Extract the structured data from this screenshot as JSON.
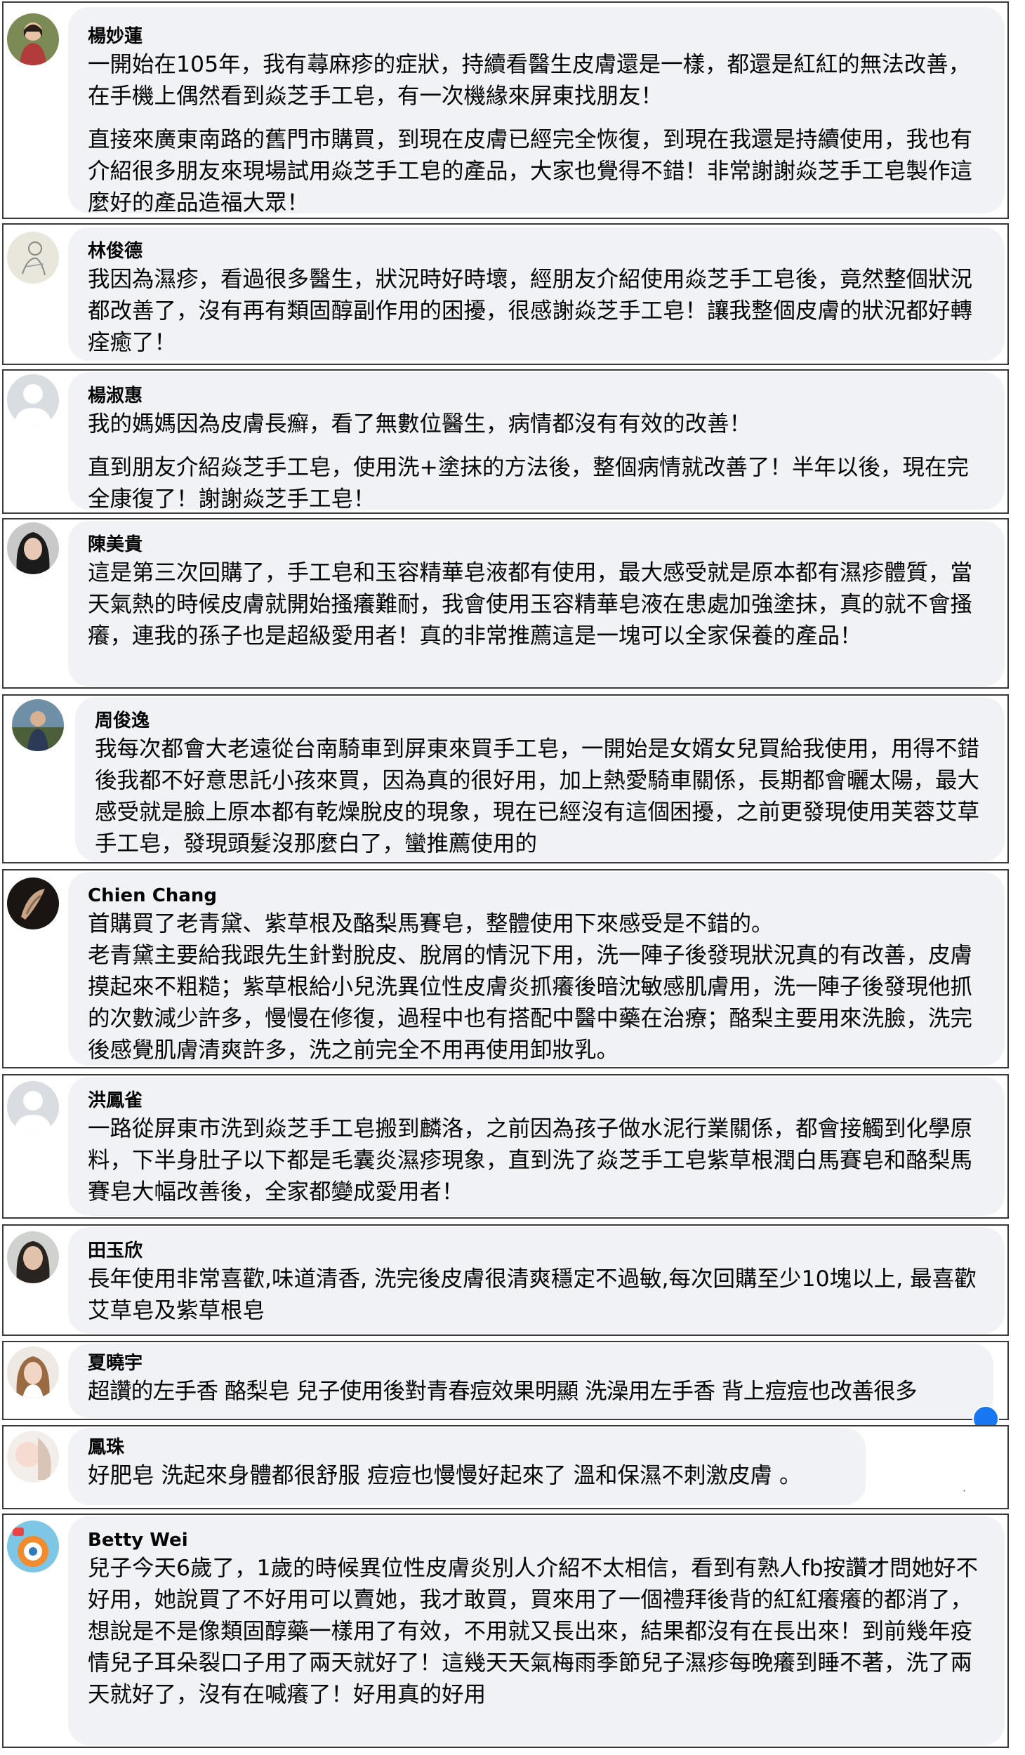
{
  "comments": [
    {
      "name": "楊妙蓮",
      "paragraphs": [
        "一開始在105年，我有蕁麻疹的症狀，持續看醫生皮膚還是一樣，都還是紅紅的無法改善，在手機上偶然看到焱芝手工皂，有一次機緣來屏東找朋友！",
        "直接來廣東南路的舊門市購買，到現在皮膚已經完全恢復，到現在我還是持續使用，我也有介紹很多朋友來現場試用焱芝手工皂的產品，大家也覺得不錯！非常謝謝焱芝手工皂製作這麼好的產品造福大眾！"
      ]
    },
    {
      "name": "林俊德",
      "paragraphs": [
        "我因為濕疹，看過很多醫生，狀況時好時壞，經朋友介紹使用焱芝手工皂後，竟然整個狀況都改善了，沒有再有類固醇副作用的困擾，很感謝焱芝手工皂！讓我整個皮膚的狀況都好轉痊癒了！"
      ]
    },
    {
      "name": "楊淑惠",
      "paragraphs": [
        "我的媽媽因為皮膚長癬，看了無數位醫生，病情都沒有有效的改善！",
        "直到朋友介紹焱芝手工皂，使用洗+塗抹的方法後，整個病情就改善了！半年以後，現在完全康復了！謝謝焱芝手工皂！"
      ]
    },
    {
      "name": "陳美貴",
      "paragraphs": [
        "這是第三次回購了，手工皂和玉容精華皂液都有使用，最大感受就是原本都有濕疹體質，當天氣熱的時候皮膚就開始搔癢難耐，我會使用玉容精華皂液在患處加強塗抹，真的就不會搔癢，連我的孫子也是超級愛用者！真的非常推薦這是一塊可以全家保養的產品！"
      ]
    },
    {
      "name": "周俊逸",
      "paragraphs": [
        "我每次都會大老遠從台南騎車到屏東來買手工皂，一開始是女婿女兒買給我使用，用得不錯後我都不好意思託小孩來買，因為真的很好用，加上熱愛騎車關係，長期都會曬太陽，最大感受就是臉上原本都有乾燥脫皮的現象，現在已經沒有這個困擾，之前更發現使用芙蓉艾草手工皂，發現頭髮沒那麼白了，蠻推薦使用的"
      ]
    },
    {
      "name": "Chien Chang",
      "paragraphs": [
        "首購買了老青黛、紫草根及酪梨馬賽皂，整體使用下來感受是不錯的。",
        "老青黛主要給我跟先生針對脫皮、脫屑的情況下用，洗一陣子後發現狀況真的有改善，皮膚摸起來不粗糙；紫草根給小兒洗異位性皮膚炎抓癢後暗沈敏感肌膚用，洗一陣子後發現他抓的次數減少許多，慢慢在修復，過程中也有搭配中醫中藥在治療；酪梨主要用來洗臉，洗完後感覺肌膚清爽許多，洗之前完全不用再使用卸妝乳。"
      ]
    },
    {
      "name": "洪鳳雀",
      "paragraphs": [
        "一路從屏東市洗到焱芝手工皂搬到麟洛，之前因為孩子做水泥行業關係，都會接觸到化學原料，下半身肚子以下都是毛囊炎濕疹現象，直到洗了焱芝手工皂紫草根潤白馬賽皂和酪梨馬賽皂大幅改善後，全家都變成愛用者！"
      ]
    },
    {
      "name": "田玉欣",
      "paragraphs": [
        "長年使用非常喜歡,味道清香, 洗完後皮膚很清爽穩定不過敏,每次回購至少10塊以上, 最喜歡艾草皂及紫草根皂"
      ]
    },
    {
      "name": "夏曉宇",
      "paragraphs": [
        "超讚的左手香 酪梨皂 兒子使用後對青春痘效果明顯 洗澡用左手香 背上痘痘也改善很多"
      ]
    },
    {
      "name": "鳳珠",
      "paragraphs": [
        "好肥皂 洗起來身體都很舒服 痘痘也慢慢好起來了 溫和保濕不刺激皮膚 。"
      ]
    },
    {
      "name": "Betty Wei",
      "paragraphs": [
        "兒子今天6歲了，1歲的時候異位性皮膚炎別人介紹不太相信，看到有熟人fb按讚才問她好不好用，她說買了不好用可以賣她，我才敢買，買來用了一個禮拜後背的紅紅癢癢的都消了，想說是不是像類固醇藥一樣用了有效，不用就又長出來，結果都沒有在長出來！到前幾年疫情兒子耳朵裂口子用了兩天就好了！這幾天天氣梅雨季節兒子濕疹每晚癢到睡不著，洗了兩天就好了，沒有在喊癢了！好用真的好用"
      ]
    }
  ]
}
